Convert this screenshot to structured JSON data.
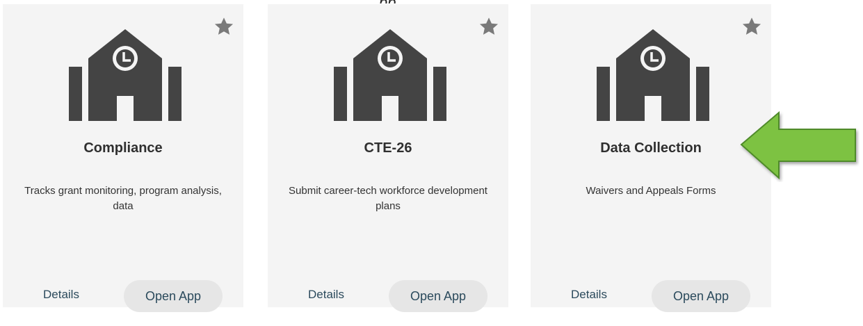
{
  "header": {
    "partial_text": "pp"
  },
  "cards": [
    {
      "title": "Compliance",
      "description": "Tracks grant monitoring, program analysis, data",
      "details_label": "Details",
      "open_label": "Open App"
    },
    {
      "title": "CTE-26",
      "description": "Submit career-tech workforce development plans",
      "details_label": "Details",
      "open_label": "Open App"
    },
    {
      "title": "Data Collection",
      "description": "Waivers and Appeals Forms",
      "details_label": "Details",
      "open_label": "Open App"
    }
  ],
  "annotation": {
    "arrow_color": "#7dc242",
    "arrow_stroke": "#4f8a2a"
  },
  "colors": {
    "card_bg": "#f4f4f4",
    "icon": "#444444",
    "link": "#2b4a5c",
    "button_bg": "#e6e6e6"
  }
}
